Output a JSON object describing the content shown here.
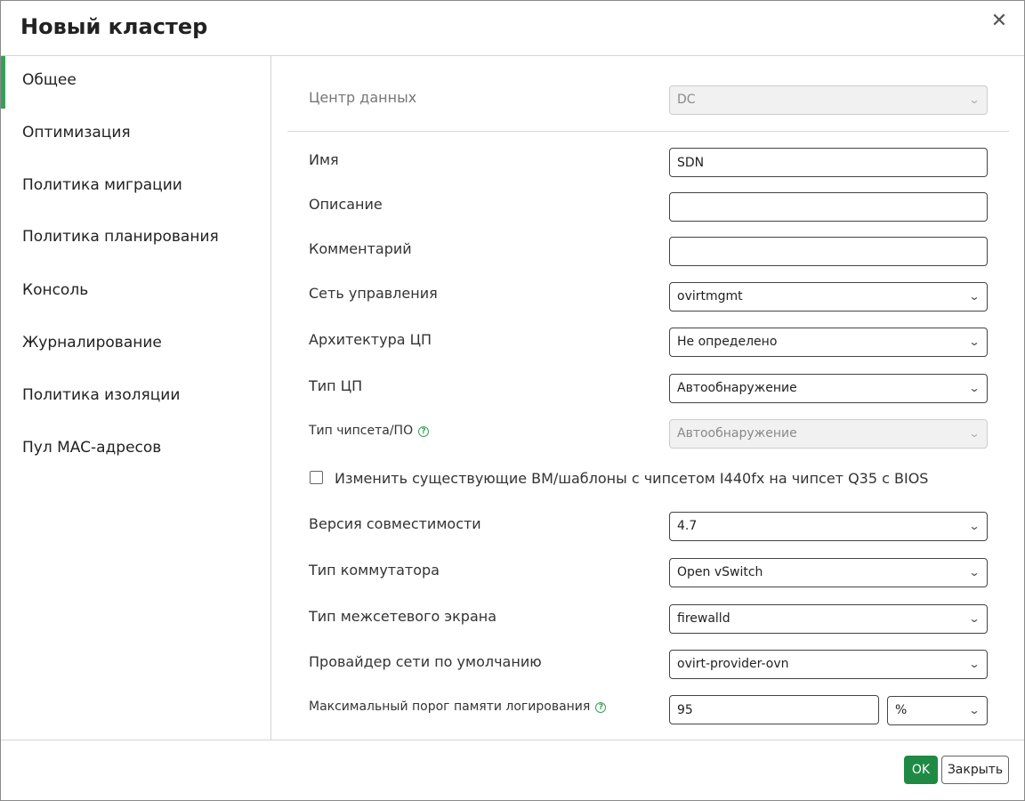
{
  "dialog": {
    "title": "Новый кластер",
    "close_icon": "close-icon"
  },
  "sidebar": {
    "items": [
      {
        "label": "Общее",
        "active": true
      },
      {
        "label": "Оптимизация"
      },
      {
        "label": "Политика миграции"
      },
      {
        "label": "Политика планирования"
      },
      {
        "label": "Консоль"
      },
      {
        "label": "Журналирование"
      },
      {
        "label": "Политика изоляции"
      },
      {
        "label": "Пул MAC-адресов"
      }
    ]
  },
  "form": {
    "datacenter": {
      "label": "Центр данных",
      "value": "DC",
      "disabled": true
    },
    "name": {
      "label": "Имя",
      "value": "SDN"
    },
    "description": {
      "label": "Описание",
      "value": ""
    },
    "comment": {
      "label": "Комментарий",
      "value": ""
    },
    "management_network": {
      "label": "Сеть управления",
      "value": "ovirtmgmt"
    },
    "cpu_architecture": {
      "label": "Архитектура ЦП",
      "value": "Не определено"
    },
    "cpu_type": {
      "label": "Тип ЦП",
      "value": "Автообнаружение"
    },
    "chipset": {
      "label": "Тип чипсета/ПО",
      "value": "Автообнаружение",
      "disabled": true
    },
    "change_chipset": {
      "label": "Изменить существующие ВМ/шаблоны с чипсетом I440fx на чипсет Q35 с BIOS",
      "checked": false
    },
    "compat_version": {
      "label": "Версия совместимости",
      "value": "4.7"
    },
    "switch_type": {
      "label": "Тип коммутатора",
      "value": "Open vSwitch"
    },
    "firewall_type": {
      "label": "Тип межсетевого экрана",
      "value": "firewalld"
    },
    "network_provider": {
      "label": "Провайдер сети по умолчанию",
      "value": "ovirt-provider-ovn"
    },
    "log_threshold": {
      "label": "Максимальный порог памяти логирования",
      "value": "95",
      "unit": "%"
    }
  },
  "footer": {
    "ok_label": "OK",
    "close_label": "Закрыть"
  },
  "colors": {
    "accent": "#3a9e5b",
    "ok_button": "#1e8a44"
  }
}
